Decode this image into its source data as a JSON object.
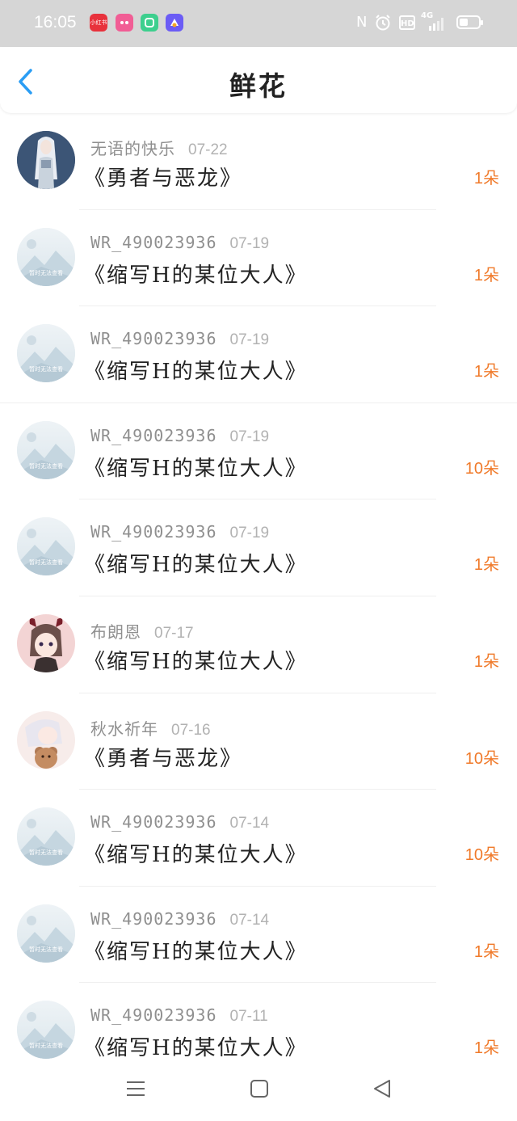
{
  "status_bar": {
    "time": "16:05",
    "app_icons": [
      {
        "name": "xiaohongshu-icon",
        "label": "小红书",
        "color": "#e8323c"
      },
      {
        "name": "pink-app-icon",
        "label": "",
        "color": "#f15d95"
      },
      {
        "name": "green-app-icon",
        "label": "",
        "color": "#3dcf8e"
      },
      {
        "name": "purple-app-icon",
        "label": "",
        "color": "#6b5cf5"
      }
    ],
    "nfc": "N",
    "alarm": "⏰",
    "hd": "HD",
    "network": "4G"
  },
  "header": {
    "back_icon": "chevron-left-icon",
    "title": "鲜花",
    "accent": "#2a9df4"
  },
  "items": [
    {
      "user": "无语的快乐",
      "date": "07-22",
      "book": "《勇者与恶龙》",
      "count": "1朵",
      "avatar": "photo-white-hair-girl"
    },
    {
      "user": "WR_490023936",
      "date": "07-19",
      "book": "《缩写H的某位大人》",
      "count": "1朵",
      "avatar": "placeholder",
      "avatar_text": "暂时无法查看"
    },
    {
      "user": "WR_490023936",
      "date": "07-19",
      "book": "《缩写H的某位大人》",
      "count": "1朵",
      "avatar": "placeholder",
      "avatar_text": "暂时无法查看"
    },
    {
      "user": "WR_490023936",
      "date": "07-19",
      "book": "《缩写H的某位大人》",
      "count": "10朵",
      "avatar": "placeholder",
      "avatar_text": "暂时无法查看"
    },
    {
      "user": "WR_490023936",
      "date": "07-19",
      "book": "《缩写H的某位大人》",
      "count": "1朵",
      "avatar": "placeholder",
      "avatar_text": "暂时无法查看"
    },
    {
      "user": "布朗恩",
      "date": "07-17",
      "book": "《缩写H的某位大人》",
      "count": "1朵",
      "avatar": "anime-devil-girl"
    },
    {
      "user": "秋水祈年",
      "date": "07-16",
      "book": "《勇者与恶龙》",
      "count": "10朵",
      "avatar": "anime-teddy-bear"
    },
    {
      "user": "WR_490023936",
      "date": "07-14",
      "book": "《缩写H的某位大人》",
      "count": "10朵",
      "avatar": "placeholder",
      "avatar_text": "暂时无法查看"
    },
    {
      "user": "WR_490023936",
      "date": "07-14",
      "book": "《缩写H的某位大人》",
      "count": "1朵",
      "avatar": "placeholder",
      "avatar_text": "暂时无法查看"
    },
    {
      "user": "WR_490023936",
      "date": "07-11",
      "book": "《缩写H的某位大人》",
      "count": "1朵",
      "avatar": "placeholder",
      "avatar_text": "暂时无法查看"
    }
  ],
  "nav_bar": {
    "menu_icon": "menu-icon",
    "home_icon": "home-square-icon",
    "back_icon": "back-triangle-icon"
  },
  "colors": {
    "count": "#f07a2a",
    "username": "#8f8f8f",
    "date": "#b2b2b2",
    "title": "#222222"
  }
}
